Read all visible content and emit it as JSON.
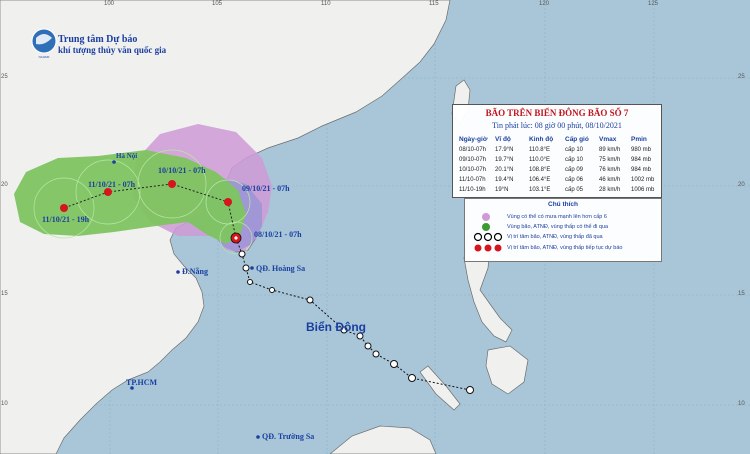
{
  "agency": {
    "name": "Trung tâm Dự báo",
    "name_full": "khí tượng thủy văn quốc gia"
  },
  "bulletin": {
    "title": "BÃO TRÊN BIỂN ĐÔNG BÃO SỐ 7",
    "subtitle": "Tin phát lúc: 08 giờ 00 phút, 08/10/2021",
    "columns": [
      "Ngày-giờ",
      "Vĩ độ",
      "Kinh độ",
      "Cấp gió",
      "Vmax",
      "Pmin"
    ],
    "rows": [
      [
        "08/10-07h",
        "17.9°N",
        "110.8°E",
        "cấp 10",
        "89 km/h",
        "980 mb"
      ],
      [
        "09/10-07h",
        "19.7°N",
        "110.0°E",
        "cấp 10",
        "75 km/h",
        "984 mb"
      ],
      [
        "10/10-07h",
        "20.1°N",
        "108.8°E",
        "cấp 09",
        "76 km/h",
        "984 mb"
      ],
      [
        "11/10-07h",
        "19.4°N",
        "106.4°E",
        "cấp 06",
        "46 km/h",
        "1002 mb"
      ],
      [
        "11/10-19h",
        "19°N",
        "103.1°E",
        "cấp 05",
        "28 km/h",
        "1006 mb"
      ]
    ]
  },
  "legend": {
    "title": "Chú thích",
    "items": [
      {
        "text": "Vùng có thể có mưa mạnh lên hơn cấp 6",
        "color": "#cf9ad6",
        "symbol": "circle"
      },
      {
        "text": "Vùng bão, ATNĐ, vùng thấp có thể đi qua",
        "color": "#3d9b34",
        "symbol": "circle"
      },
      {
        "text": "Vị trí tâm bão, ATNĐ, vùng thấp đã qua",
        "color": "#000000",
        "symbol": "marks"
      },
      {
        "text": "Vị trí tâm bão, ATNĐ, vùng thấp tiếp tục dự báo",
        "color": "#d6151c",
        "symbol": "marks"
      }
    ]
  },
  "map_labels": {
    "ha_noi": "Hà Nội",
    "da_nang": "Đ.Nẵng",
    "tp_hcm": "TP.HCM",
    "hoang_sa": "QĐ. Hoàng Sa",
    "truong_sa": "QĐ. Trường Sa",
    "bien_dong": "Biển Đông"
  },
  "forecast_labels": [
    {
      "id": "f4",
      "text": "11/10/21 - 19h"
    },
    {
      "id": "f3",
      "text": "11/10/21 - 07h"
    },
    {
      "id": "f2",
      "text": "10/10/21 - 07h"
    },
    {
      "id": "f1",
      "text": "09/10/21 - 07h"
    },
    {
      "id": "f0",
      "text": "08/10/21 - 07h"
    }
  ],
  "axis_labels": {
    "top": [
      "100",
      "105",
      "110",
      "115",
      "120",
      "125",
      "130"
    ],
    "left": [
      "25",
      "20",
      "15",
      "10"
    ],
    "right": [
      "25",
      "20",
      "15",
      "10"
    ]
  },
  "colors": {
    "sea": "#a8c6d8",
    "land": "#f0f0ef",
    "coast": "#6d6d6d",
    "rain_zone": "#cf9ad6",
    "storm_zone": "#7ec460",
    "uncertainty": "#9a94d6",
    "track_past": "#000000",
    "track_forecast": "#d6151c"
  }
}
